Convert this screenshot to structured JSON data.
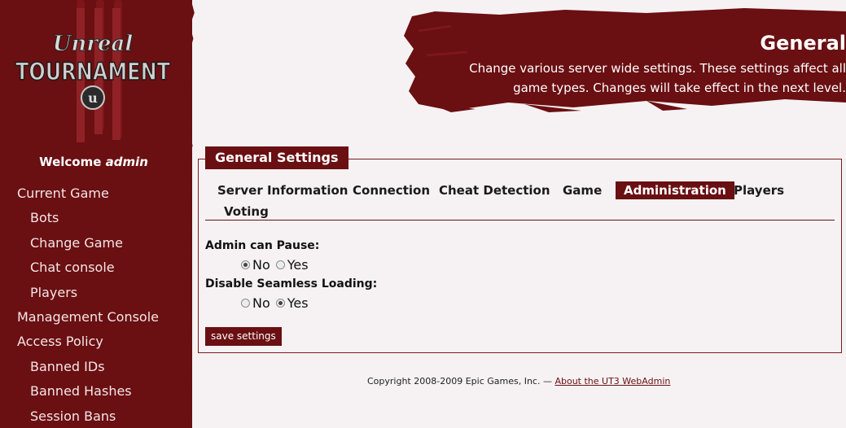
{
  "sidebar": {
    "logo_text": "Unreal Tournament",
    "welcome_prefix": "Welcome",
    "welcome_user": "admin",
    "items": [
      {
        "label": "Current Game",
        "level": 1
      },
      {
        "label": "Bots",
        "level": 2
      },
      {
        "label": "Change Game",
        "level": 2
      },
      {
        "label": "Chat console",
        "level": 2
      },
      {
        "label": "Players",
        "level": 2
      },
      {
        "label": "Management Console",
        "level": 1
      },
      {
        "label": "Access Policy",
        "level": 1
      },
      {
        "label": "Banned IDs",
        "level": 2
      },
      {
        "label": "Banned Hashes",
        "level": 2
      },
      {
        "label": "Session Bans",
        "level": 2
      }
    ]
  },
  "header": {
    "title": "General",
    "description": "Change various server wide settings. These settings affect all game types. Changes will take effect in the next level."
  },
  "panel": {
    "legend": "General Settings",
    "tabs": [
      {
        "label": "Server Information",
        "active": false
      },
      {
        "label": "Connection",
        "active": false
      },
      {
        "label": "Cheat Detection",
        "active": false
      },
      {
        "label": "Game",
        "active": false
      },
      {
        "label": "Administration",
        "active": true
      },
      {
        "label": "Players",
        "active": false
      },
      {
        "label": "Voting",
        "active": false
      }
    ],
    "fields": [
      {
        "label": "Admin can Pause:",
        "options": [
          "No",
          "Yes"
        ],
        "selected": "No"
      },
      {
        "label": "Disable Seamless Loading:",
        "options": [
          "No",
          "Yes"
        ],
        "selected": "Yes"
      }
    ],
    "save_label": "save settings"
  },
  "footer": {
    "copyright": "Copyright 2008-2009 Epic Games, Inc. —",
    "link_text": "About the UT3 WebAdmin"
  },
  "colors": {
    "brand": "#6a0f12",
    "background": "#f6f2f3"
  }
}
